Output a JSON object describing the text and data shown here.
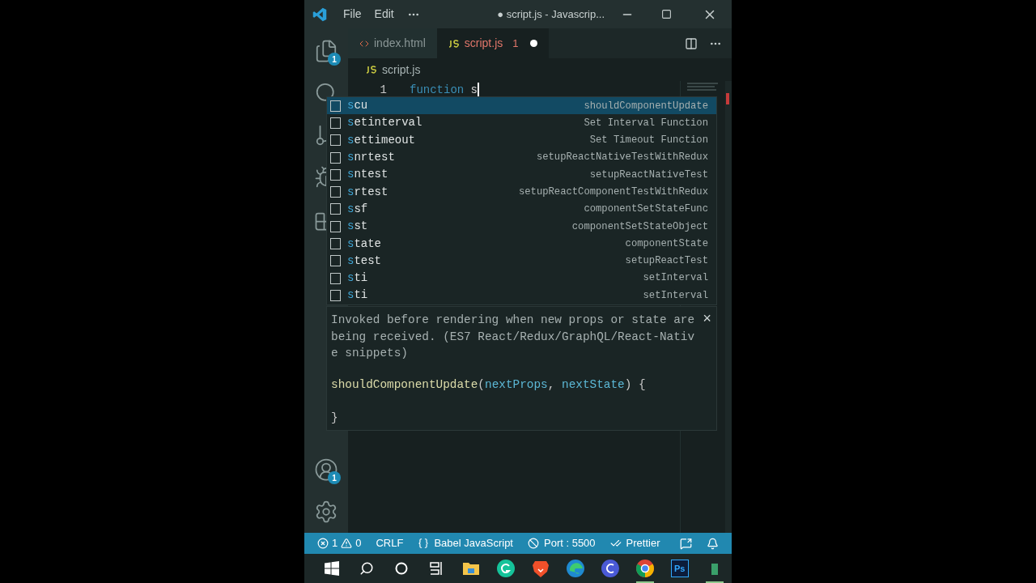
{
  "title_bar": {
    "menu": [
      "File",
      "Edit"
    ],
    "title": "● script.js - Javascrip..."
  },
  "activity_bar": {
    "top": [
      {
        "kind": "files",
        "badge": "1"
      },
      {
        "kind": "search"
      },
      {
        "kind": "source-control"
      },
      {
        "kind": "debug"
      },
      {
        "kind": "extensions"
      }
    ],
    "bottom": [
      {
        "kind": "account",
        "badge": "1"
      },
      {
        "kind": "settings"
      }
    ]
  },
  "tabs": [
    {
      "label": "index.html",
      "kind": "html",
      "selected": false
    },
    {
      "label": "script.js",
      "kind": "js",
      "selected": true,
      "problems": "1",
      "dirty": true
    }
  ],
  "breadcrumb": {
    "kind": "js",
    "label": "script.js"
  },
  "editor": {
    "lines": [
      {
        "number": "1",
        "tokens": [
          {
            "kind": "keyword",
            "text": "function"
          },
          {
            "kind": "plain",
            "text": " s"
          }
        ]
      }
    ]
  },
  "suggest": {
    "items": [
      {
        "label": "scu",
        "detail": "shouldComponentUpdate",
        "selected": true
      },
      {
        "label": "setinterval",
        "detail": "Set Interval Function",
        "selected": false
      },
      {
        "label": "settimeout",
        "detail": "Set Timeout Function",
        "selected": false
      },
      {
        "label": "snrtest",
        "detail": "setupReactNativeTestWithRedux",
        "selected": false
      },
      {
        "label": "sntest",
        "detail": "setupReactNativeTest",
        "selected": false
      },
      {
        "label": "srtest",
        "detail": "setupReactComponentTestWithRedux",
        "selected": false
      },
      {
        "label": "ssf",
        "detail": "componentSetStateFunc",
        "selected": false
      },
      {
        "label": "sst",
        "detail": "componentSetStateObject",
        "selected": false
      },
      {
        "label": "state",
        "detail": "componentState",
        "selected": false
      },
      {
        "label": "stest",
        "detail": "setupReactTest",
        "selected": false
      },
      {
        "label": "sti",
        "detail": "setInterval",
        "selected": false
      },
      {
        "label": "sti",
        "detail": "setInterval",
        "selected": false
      }
    ],
    "docs": {
      "description": "Invoked before rendering when new props or state are being received. (ES7 React/Redux/GraphQL/React-Native snippets)",
      "close": "×",
      "code": [
        [
          {
            "kind": "function",
            "text": "shouldComponentUpdate"
          },
          {
            "kind": "punct",
            "text": "("
          },
          {
            "kind": "param",
            "text": "nextProps"
          },
          {
            "kind": "punct",
            "text": ", "
          },
          {
            "kind": "param",
            "text": "nextState"
          },
          {
            "kind": "punct",
            "text": ") {"
          }
        ],
        [
          {
            "kind": "punct",
            "text": "}"
          }
        ]
      ]
    }
  },
  "status_bar": {
    "errors": "1",
    "warnings": "0",
    "items": [
      {
        "kind": "text",
        "label": "CRLF"
      },
      {
        "kind": "braces",
        "label": "Babel JavaScript"
      },
      {
        "kind": "port",
        "label": "Port : 5500"
      },
      {
        "kind": "prettier",
        "label": "Prettier"
      }
    ]
  },
  "taskbar": [
    {
      "kind": "windows"
    },
    {
      "kind": "search"
    },
    {
      "kind": "cortana"
    },
    {
      "kind": "taskview"
    },
    {
      "kind": "folder"
    },
    {
      "kind": "grammarly"
    },
    {
      "kind": "brave"
    },
    {
      "kind": "edge"
    },
    {
      "kind": "canva"
    },
    {
      "kind": "chrome",
      "running": true
    },
    {
      "kind": "photoshop",
      "label": "Ps"
    },
    {
      "kind": "partial",
      "running": true
    }
  ]
}
